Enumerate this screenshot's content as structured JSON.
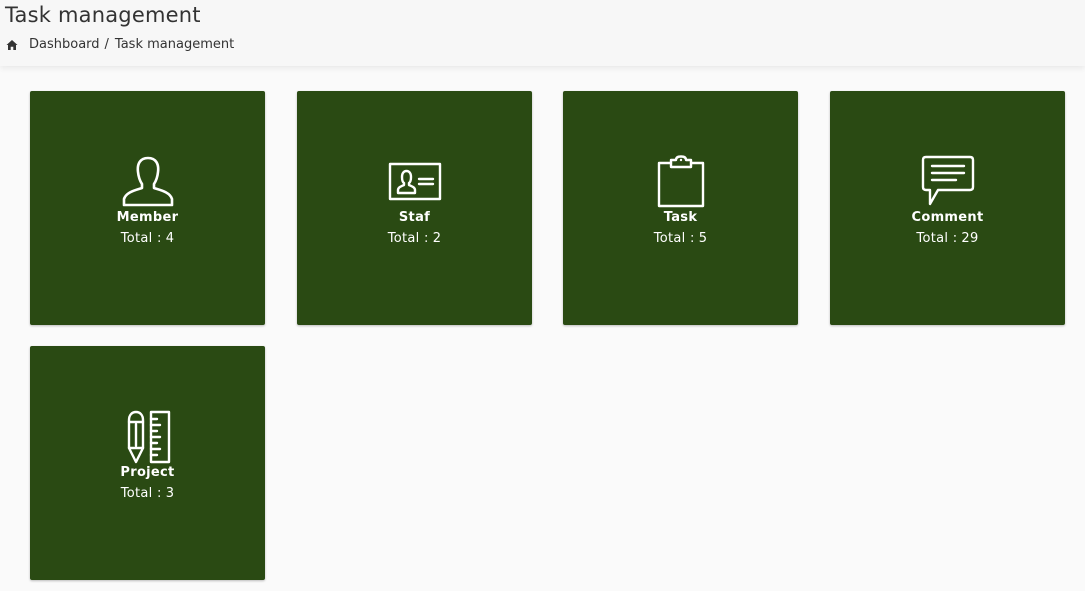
{
  "header": {
    "title": "Task management"
  },
  "breadcrumb": {
    "icon": "home-icon",
    "items": [
      {
        "label": "Dashboard",
        "separator": "/"
      },
      {
        "label": "Task management"
      }
    ]
  },
  "tiles": [
    {
      "label": "Member",
      "total_label": "Total :",
      "total": "4",
      "icon": "user-icon"
    },
    {
      "label": "Staf",
      "total_label": "Total :",
      "total": "2",
      "icon": "id-card-icon"
    },
    {
      "label": "Task",
      "total_label": "Total :",
      "total": "5",
      "icon": "clipboard-icon"
    },
    {
      "label": "Comment",
      "total_label": "Total :",
      "total": "29",
      "icon": "comment-icon"
    },
    {
      "label": "Project",
      "total_label": "Total :",
      "total": "3",
      "icon": "pencil-ruler-icon"
    }
  ],
  "colors": {
    "tile_background": "#2a4a13",
    "page_background": "#fafafa",
    "header_background": "#f7f7f7"
  }
}
